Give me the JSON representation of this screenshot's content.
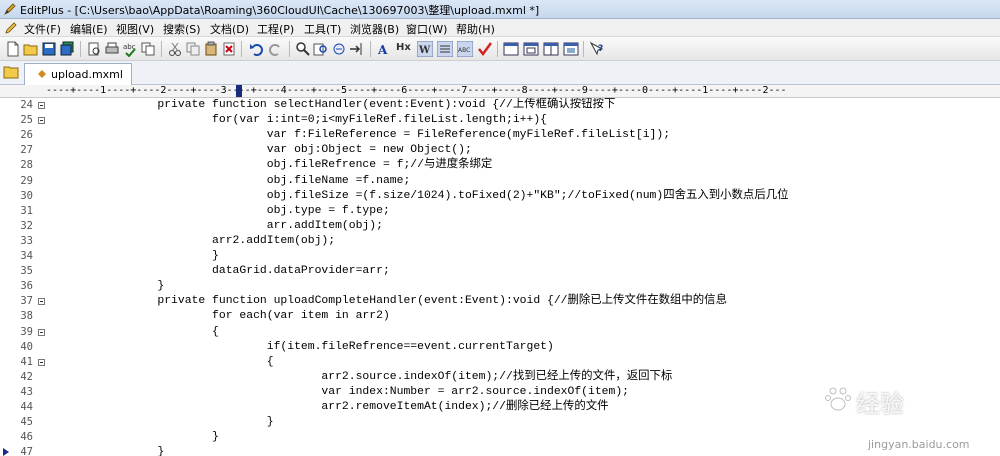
{
  "window": {
    "title": "EditPlus - [C:\\Users\\bao\\AppData\\Roaming\\360CloudUI\\Cache\\130697003\\整理\\upload.mxml *]"
  },
  "menu": {
    "items": [
      "文件(F)",
      "编辑(E)",
      "视图(V)",
      "搜索(S)",
      "文档(D)",
      "工程(P)",
      "工具(T)",
      "浏览器(B)",
      "窗口(W)",
      "帮助(H)"
    ]
  },
  "toolbar": {
    "icons": [
      "new-file-icon",
      "open-folder-icon",
      "save-icon",
      "save-all-icon",
      "print-preview-icon",
      "print-icon",
      "spell-check-icon",
      "cut-icon",
      "copy-icon",
      "paste-icon",
      "delete-icon",
      "undo-icon",
      "redo-icon",
      "find-icon",
      "find-in-files-icon",
      "replace-icon",
      "goto-icon",
      "bold-a-icon",
      "hx-icon",
      "word-wrap-icon",
      "line-number-icon",
      "column-icon",
      "check-icon",
      "window-tile-icon",
      "window-cascade-icon",
      "window-split-icon",
      "window-full-icon",
      "help-icon"
    ],
    "labels": {
      "hx": "Hx"
    }
  },
  "tabs": [
    {
      "label": "upload.mxml"
    }
  ],
  "ruler": {
    "text": "----+----1----+----2----+----3----+----4----+----5----+----6----+----7----+----8----+----9----+----0----+----1----+----2---"
  },
  "editor": {
    "lines": [
      {
        "num": "24",
        "fold": true,
        "code": "                private function selectHandler(event:Event):void {//上传框确认按钮按下"
      },
      {
        "num": "25",
        "fold": true,
        "code": "                        for(var i:int=0;i<myFileRef.fileList.length;i++){"
      },
      {
        "num": "26",
        "fold": false,
        "code": "                                var f:FileReference = FileReference(myFileRef.fileList[i]);"
      },
      {
        "num": "27",
        "fold": false,
        "code": "                                var obj:Object = new Object();"
      },
      {
        "num": "28",
        "fold": false,
        "code": "                                obj.fileRefrence = f;//与进度条绑定"
      },
      {
        "num": "29",
        "fold": false,
        "code": "                                obj.fileName =f.name;"
      },
      {
        "num": "30",
        "fold": false,
        "code": "                                obj.fileSize =(f.size/1024).toFixed(2)+\"KB\";//toFixed(num)四舍五入到小数点后几位"
      },
      {
        "num": "31",
        "fold": false,
        "code": "                                obj.type = f.type;"
      },
      {
        "num": "32",
        "fold": false,
        "code": "                                arr.addItem(obj);"
      },
      {
        "num": "33",
        "fold": false,
        "code": "                        arr2.addItem(obj);"
      },
      {
        "num": "34",
        "fold": false,
        "code": "                        }"
      },
      {
        "num": "35",
        "fold": false,
        "code": "                        dataGrid.dataProvider=arr;"
      },
      {
        "num": "36",
        "fold": false,
        "code": "                }"
      },
      {
        "num": "37",
        "fold": true,
        "code": "                private function uploadCompleteHandler(event:Event):void {//删除已上传文件在数组中的信息"
      },
      {
        "num": "38",
        "fold": false,
        "code": "                        for each(var item in arr2)"
      },
      {
        "num": "39",
        "fold": true,
        "code": "                        {"
      },
      {
        "num": "40",
        "fold": false,
        "code": "                                if(item.fileRefrence==event.currentTarget)"
      },
      {
        "num": "41",
        "fold": true,
        "code": "                                {"
      },
      {
        "num": "42",
        "fold": false,
        "code": "                                        arr2.source.indexOf(item);//找到已经上传的文件，返回下标"
      },
      {
        "num": "43",
        "fold": false,
        "code": "                                        var index:Number = arr2.source.indexOf(item);"
      },
      {
        "num": "44",
        "fold": false,
        "code": "                                        arr2.removeItemAt(index);//删除已经上传的文件"
      },
      {
        "num": "45",
        "fold": false,
        "code": "                                }"
      },
      {
        "num": "46",
        "fold": false,
        "code": "                        }"
      },
      {
        "num": "47",
        "fold": false,
        "code": "                }"
      }
    ]
  },
  "watermark": {
    "brand": "经验",
    "url": "jingyan.baidu.com"
  },
  "colors": {
    "title_bg": "#c6d8ee",
    "ruler_cursor": "#1a2a7a",
    "gutter_marker": "#1a2a8a"
  }
}
